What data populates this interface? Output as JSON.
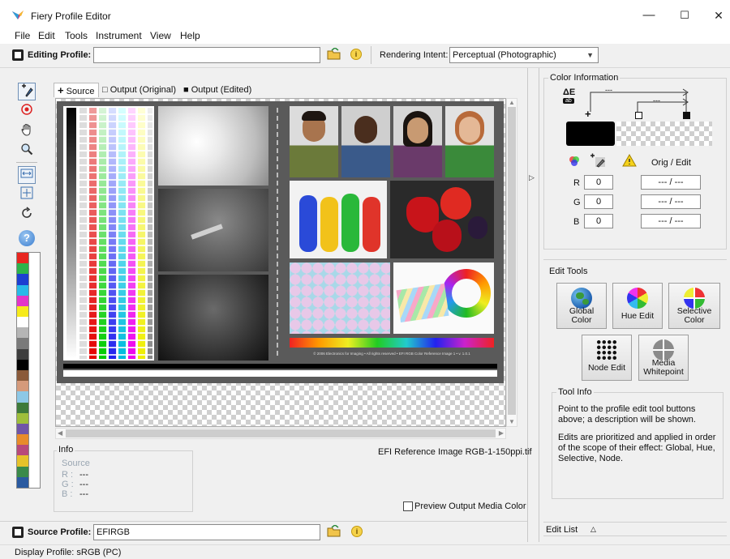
{
  "window": {
    "title": "Fiery Profile Editor",
    "minimize": "—",
    "maximize": "☐",
    "close": "✕"
  },
  "menu": [
    "File",
    "Edit",
    "Tools",
    "Instrument",
    "View",
    "Help"
  ],
  "editing": {
    "label": "Editing Profile:",
    "value": "",
    "rendering_label": "Rendering Intent:",
    "rendering_value": "Perceptual (Photographic)"
  },
  "tabs": [
    {
      "label": "Source",
      "icon": "+",
      "active": true
    },
    {
      "label": "Output (Original)",
      "icon": "□",
      "active": false
    },
    {
      "label": "Output (Edited)",
      "icon": "■",
      "active": false
    }
  ],
  "tools": [
    {
      "name": "eyedropper-add-icon",
      "glyph": "✚"
    },
    {
      "name": "target-icon",
      "glyph": "◉"
    },
    {
      "name": "hand-icon",
      "glyph": "✋"
    },
    {
      "name": "zoom-icon",
      "glyph": "🔍"
    },
    {
      "name": "fit-width-icon",
      "glyph": "↔"
    },
    {
      "name": "fit-page-icon",
      "glyph": "⤢"
    },
    {
      "name": "refresh-icon",
      "glyph": "↻"
    },
    {
      "name": "help-icon",
      "glyph": "?"
    }
  ],
  "swatches": [
    "#e8251f",
    "#2db34a",
    "#1d3fd1",
    "#29b9e8",
    "#e335c8",
    "#f6ea1b",
    "#ffffff",
    "#b5b5b5",
    "#7a7a7a",
    "#3d3d3d",
    "#000000",
    "#8a5a3a",
    "#d59a7b",
    "#8dc8e6",
    "#3e7a3a",
    "#9fbf3b",
    "#7055a8",
    "#e88c2a",
    "#b84a7a",
    "#e6c22a",
    "#3a8a4a",
    "#2a5aa0"
  ],
  "image": {
    "filename": "EFI Reference Image RGB-1-150ppi.tif",
    "copyright": "© 2006 Electronics for Imaging • All rights reserved • EFI RGB Color Reference Image 1 • v. 1.0.1"
  },
  "info": {
    "label": "Info",
    "source": "Source",
    "r_label": "R :",
    "g_label": "G :",
    "b_label": "B :",
    "r": "---",
    "g": "---",
    "b": "---"
  },
  "preview_output_media_color": "Preview Output Media Color",
  "source_profile": {
    "label": "Source Profile:",
    "value": "EFIRGB"
  },
  "color_information": {
    "title": "Color Information",
    "delta_e": "ΔE",
    "delta_sub": "ab",
    "dash_top": "---",
    "dash_mid": "---",
    "orig_edit": "Orig / Edit",
    "channels": [
      {
        "label": "R",
        "value": "0",
        "orig_edit": "--- /  ---"
      },
      {
        "label": "G",
        "value": "0",
        "orig_edit": "--- /  ---"
      },
      {
        "label": "B",
        "value": "0",
        "orig_edit": "--- /  ---"
      }
    ]
  },
  "edit_tools": {
    "title": "Edit Tools",
    "buttons": [
      {
        "name": "global-color",
        "line1": "Global",
        "line2": "Color"
      },
      {
        "name": "hue-edit",
        "line1": "Hue Edit",
        "line2": ""
      },
      {
        "name": "selective-color",
        "line1": "Selective",
        "line2": "Color"
      },
      {
        "name": "node-edit",
        "line1": "Node Edit",
        "line2": ""
      },
      {
        "name": "media-whitepoint",
        "line1": "Media",
        "line2": "Whitepoint"
      }
    ]
  },
  "tool_info": {
    "title": "Tool Info",
    "text1": "Point to the profile edit tool buttons above; a description will be shown.",
    "text2": "Edits are prioritized and applied in order of the scope of their effect:  Global, Hue, Selective, Node."
  },
  "edit_list": {
    "label": "Edit List",
    "caret": "△"
  },
  "status": {
    "display_profile": "Display Profile:  sRGB (PC)"
  },
  "colors": {
    "accent": "#1a73d9",
    "panel_border": "#c8c8c8"
  }
}
